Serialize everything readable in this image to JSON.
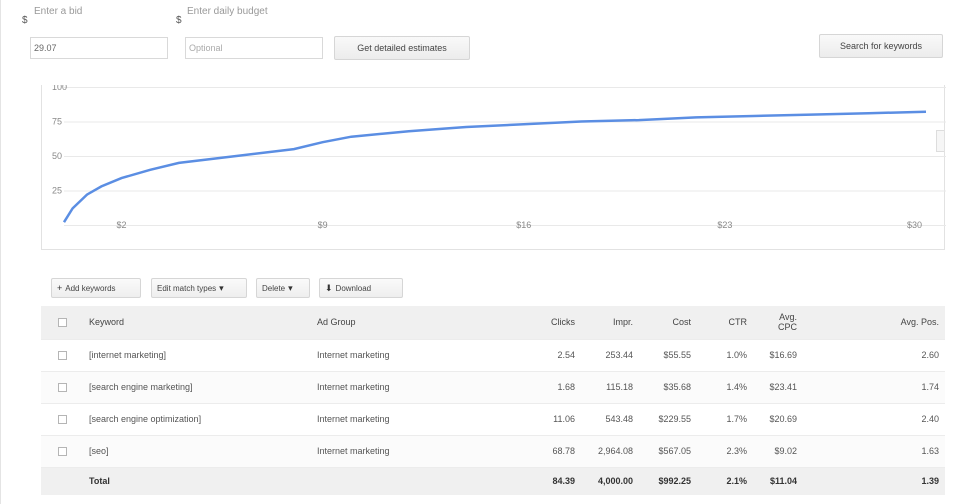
{
  "controls": {
    "bid_label": "Enter a bid",
    "bid_currency": "$",
    "bid_value": "29.07",
    "budget_label": "Enter daily budget",
    "budget_currency": "$",
    "budget_placeholder": "Optional",
    "estimates_button": "Get detailed estimates",
    "search_button": "Search for keywords"
  },
  "chart_data": {
    "type": "line",
    "x_ticks": [
      "$2",
      "$9",
      "$16",
      "$23",
      "$30"
    ],
    "y_ticks": [
      "100",
      "75",
      "50",
      "25"
    ],
    "ylim": [
      0,
      100
    ],
    "xlim": [
      0,
      30
    ],
    "series": [
      {
        "color": "#5b8ee3",
        "x": [
          0,
          0.3,
          0.8,
          1.3,
          2,
          3,
          4,
          6,
          8,
          9,
          10,
          12,
          14,
          16,
          18,
          20,
          22,
          24,
          26,
          28,
          30
        ],
        "y": [
          2,
          12,
          22,
          28,
          34,
          40,
          45,
          50,
          55,
          60,
          64,
          68,
          71,
          73,
          75,
          76,
          78,
          79,
          80,
          81,
          82
        ]
      }
    ]
  },
  "toolbar": {
    "add_label": "Add keywords",
    "edit_label": "Edit match types",
    "delete_label": "Delete",
    "download_label": "Download"
  },
  "table": {
    "headers": [
      "Keyword",
      "Ad Group",
      "Clicks",
      "Impr.",
      "Cost",
      "CTR",
      "Avg. CPC",
      "Avg. Pos."
    ],
    "rows": [
      {
        "keyword": "[internet marketing]",
        "ad_group": "Internet marketing",
        "clicks": "2.54",
        "impr": "253.44",
        "cost": "$55.55",
        "ctr": "1.0%",
        "cpc": "$16.69",
        "pos": "2.60"
      },
      {
        "keyword": "[search engine marketing]",
        "ad_group": "Internet marketing",
        "clicks": "1.68",
        "impr": "115.18",
        "cost": "$35.68",
        "ctr": "1.4%",
        "cpc": "$23.41",
        "pos": "1.74"
      },
      {
        "keyword": "[search engine optimization]",
        "ad_group": "Internet marketing",
        "clicks": "11.06",
        "impr": "543.48",
        "cost": "$229.55",
        "ctr": "1.7%",
        "cpc": "$20.69",
        "pos": "2.40"
      },
      {
        "keyword": "[seo]",
        "ad_group": "Internet marketing",
        "clicks": "68.78",
        "impr": "2,964.08",
        "cost": "$567.05",
        "ctr": "2.3%",
        "cpc": "$9.02",
        "pos": "1.63"
      }
    ],
    "total": {
      "label": "Total",
      "clicks": "84.39",
      "impr": "4,000.00",
      "cost": "$992.25",
      "ctr": "2.1%",
      "cpc": "$11.04",
      "pos": "1.39"
    }
  }
}
